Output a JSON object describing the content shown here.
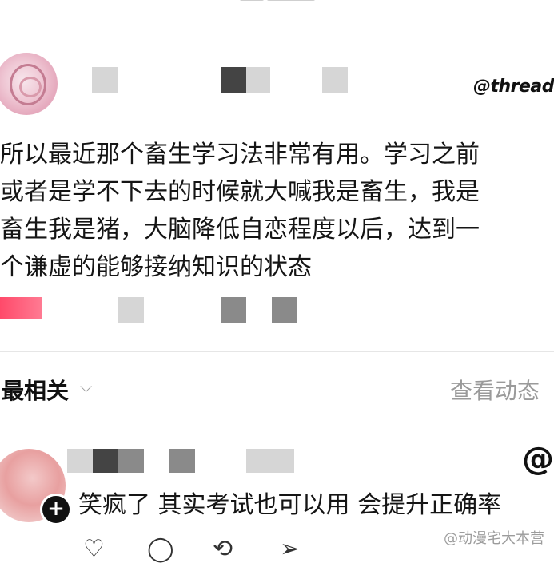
{
  "post": {
    "threads_label": "@thread",
    "lines": [
      "所以最近那个畜生学习法非常有用。学习之前",
      "或者是学不下去的时候就大喊我是畜生，我是",
      "畜生我是猪，大脑降低自恋程度以后，达到一",
      "个谦虚的能够接纳知识的状态"
    ]
  },
  "comments_header": {
    "sort_label": "最相关",
    "sort_icon": "chevron-down-icon",
    "view_activity": "查看动态"
  },
  "comment": {
    "plus_symbol": "+",
    "text": "笑疯了 其实考试也可以用 会提升正确率",
    "at_symbol": "@"
  },
  "actions": {
    "like_icon": "heart-icon",
    "reply_icon": "comment-icon",
    "repost_icon": "repost-icon",
    "share_icon": "send-icon"
  },
  "watermark": "@动漫宅大本营"
}
